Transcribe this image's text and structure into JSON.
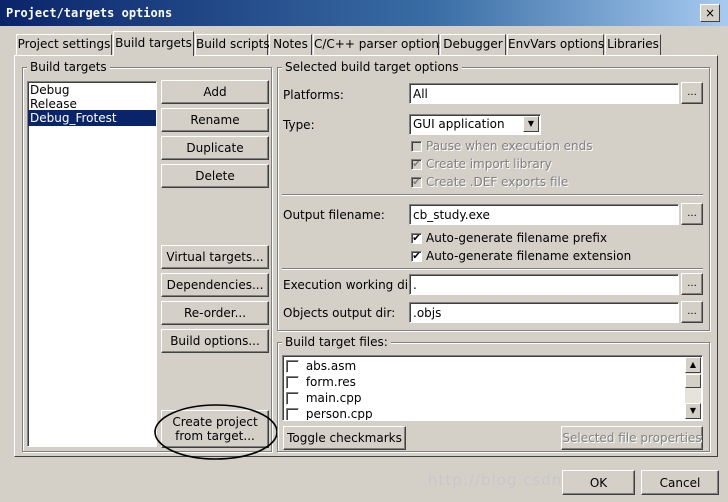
{
  "window": {
    "title": "Project/targets options",
    "close_label": "×"
  },
  "tabs": [
    {
      "label": "Project settings"
    },
    {
      "label": "Build targets"
    },
    {
      "label": "Build scripts"
    },
    {
      "label": "Notes"
    },
    {
      "label": "C/C++ parser options"
    },
    {
      "label": "Debugger"
    },
    {
      "label": "EnvVars options"
    },
    {
      "label": "Libraries"
    }
  ],
  "build_targets": {
    "legend": "Build targets",
    "items": [
      "Debug",
      "Release",
      "Debug_Frotest"
    ],
    "selected": "Debug_Frotest",
    "buttons": {
      "add": "Add",
      "rename": "Rename",
      "duplicate": "Duplicate",
      "delete": "Delete",
      "virtual_targets": "Virtual targets...",
      "dependencies": "Dependencies...",
      "reorder": "Re-order...",
      "build_options": "Build options...",
      "create_line1": "Create project",
      "create_line2": "from target..."
    }
  },
  "options": {
    "legend": "Selected build target options",
    "platforms_label": "Platforms:",
    "platforms_value": "All",
    "type_label": "Type:",
    "type_value": "GUI application",
    "pause_label": "Pause when execution ends",
    "import_label": "Create import library",
    "def_label": "Create .DEF exports file",
    "output_label": "Output filename:",
    "output_value": "cb_study.exe",
    "prefix_label": "Auto-generate filename prefix",
    "extension_label": "Auto-generate filename extension",
    "exec_dir_label": "Execution working dir:",
    "exec_dir_value": ".",
    "obj_dir_label": "Objects output dir:",
    "obj_dir_value": ".objs",
    "browse": "...",
    "check_mark": "✔"
  },
  "files": {
    "legend": "Build target files:",
    "items": [
      "abs.asm",
      "form.res",
      "main.cpp",
      "person.cpp"
    ],
    "toggle_label": "Toggle checkmarks",
    "properties_label": "Selected file properties"
  },
  "footer": {
    "ok": "OK",
    "cancel": "Cancel",
    "watermark": "http://blog.csdn.net/yourname"
  }
}
